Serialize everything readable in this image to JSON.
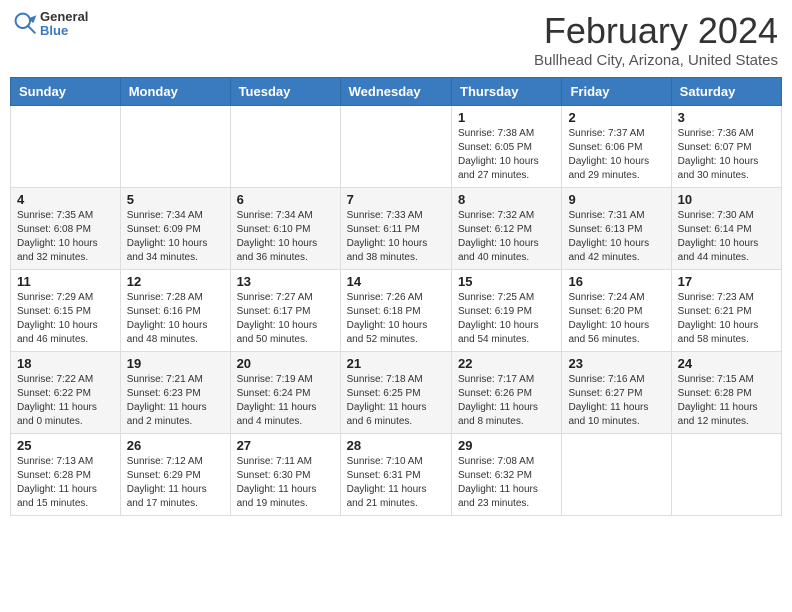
{
  "header": {
    "logo_general": "General",
    "logo_blue": "Blue",
    "month_title": "February 2024",
    "location": "Bullhead City, Arizona, United States"
  },
  "days_of_week": [
    "Sunday",
    "Monday",
    "Tuesday",
    "Wednesday",
    "Thursday",
    "Friday",
    "Saturday"
  ],
  "weeks": [
    [
      {
        "day": "",
        "info": ""
      },
      {
        "day": "",
        "info": ""
      },
      {
        "day": "",
        "info": ""
      },
      {
        "day": "",
        "info": ""
      },
      {
        "day": "1",
        "info": "Sunrise: 7:38 AM\nSunset: 6:05 PM\nDaylight: 10 hours and 27 minutes."
      },
      {
        "day": "2",
        "info": "Sunrise: 7:37 AM\nSunset: 6:06 PM\nDaylight: 10 hours and 29 minutes."
      },
      {
        "day": "3",
        "info": "Sunrise: 7:36 AM\nSunset: 6:07 PM\nDaylight: 10 hours and 30 minutes."
      }
    ],
    [
      {
        "day": "4",
        "info": "Sunrise: 7:35 AM\nSunset: 6:08 PM\nDaylight: 10 hours and 32 minutes."
      },
      {
        "day": "5",
        "info": "Sunrise: 7:34 AM\nSunset: 6:09 PM\nDaylight: 10 hours and 34 minutes."
      },
      {
        "day": "6",
        "info": "Sunrise: 7:34 AM\nSunset: 6:10 PM\nDaylight: 10 hours and 36 minutes."
      },
      {
        "day": "7",
        "info": "Sunrise: 7:33 AM\nSunset: 6:11 PM\nDaylight: 10 hours and 38 minutes."
      },
      {
        "day": "8",
        "info": "Sunrise: 7:32 AM\nSunset: 6:12 PM\nDaylight: 10 hours and 40 minutes."
      },
      {
        "day": "9",
        "info": "Sunrise: 7:31 AM\nSunset: 6:13 PM\nDaylight: 10 hours and 42 minutes."
      },
      {
        "day": "10",
        "info": "Sunrise: 7:30 AM\nSunset: 6:14 PM\nDaylight: 10 hours and 44 minutes."
      }
    ],
    [
      {
        "day": "11",
        "info": "Sunrise: 7:29 AM\nSunset: 6:15 PM\nDaylight: 10 hours and 46 minutes."
      },
      {
        "day": "12",
        "info": "Sunrise: 7:28 AM\nSunset: 6:16 PM\nDaylight: 10 hours and 48 minutes."
      },
      {
        "day": "13",
        "info": "Sunrise: 7:27 AM\nSunset: 6:17 PM\nDaylight: 10 hours and 50 minutes."
      },
      {
        "day": "14",
        "info": "Sunrise: 7:26 AM\nSunset: 6:18 PM\nDaylight: 10 hours and 52 minutes."
      },
      {
        "day": "15",
        "info": "Sunrise: 7:25 AM\nSunset: 6:19 PM\nDaylight: 10 hours and 54 minutes."
      },
      {
        "day": "16",
        "info": "Sunrise: 7:24 AM\nSunset: 6:20 PM\nDaylight: 10 hours and 56 minutes."
      },
      {
        "day": "17",
        "info": "Sunrise: 7:23 AM\nSunset: 6:21 PM\nDaylight: 10 hours and 58 minutes."
      }
    ],
    [
      {
        "day": "18",
        "info": "Sunrise: 7:22 AM\nSunset: 6:22 PM\nDaylight: 11 hours and 0 minutes."
      },
      {
        "day": "19",
        "info": "Sunrise: 7:21 AM\nSunset: 6:23 PM\nDaylight: 11 hours and 2 minutes."
      },
      {
        "day": "20",
        "info": "Sunrise: 7:19 AM\nSunset: 6:24 PM\nDaylight: 11 hours and 4 minutes."
      },
      {
        "day": "21",
        "info": "Sunrise: 7:18 AM\nSunset: 6:25 PM\nDaylight: 11 hours and 6 minutes."
      },
      {
        "day": "22",
        "info": "Sunrise: 7:17 AM\nSunset: 6:26 PM\nDaylight: 11 hours and 8 minutes."
      },
      {
        "day": "23",
        "info": "Sunrise: 7:16 AM\nSunset: 6:27 PM\nDaylight: 11 hours and 10 minutes."
      },
      {
        "day": "24",
        "info": "Sunrise: 7:15 AM\nSunset: 6:28 PM\nDaylight: 11 hours and 12 minutes."
      }
    ],
    [
      {
        "day": "25",
        "info": "Sunrise: 7:13 AM\nSunset: 6:28 PM\nDaylight: 11 hours and 15 minutes."
      },
      {
        "day": "26",
        "info": "Sunrise: 7:12 AM\nSunset: 6:29 PM\nDaylight: 11 hours and 17 minutes."
      },
      {
        "day": "27",
        "info": "Sunrise: 7:11 AM\nSunset: 6:30 PM\nDaylight: 11 hours and 19 minutes."
      },
      {
        "day": "28",
        "info": "Sunrise: 7:10 AM\nSunset: 6:31 PM\nDaylight: 11 hours and 21 minutes."
      },
      {
        "day": "29",
        "info": "Sunrise: 7:08 AM\nSunset: 6:32 PM\nDaylight: 11 hours and 23 minutes."
      },
      {
        "day": "",
        "info": ""
      },
      {
        "day": "",
        "info": ""
      }
    ]
  ]
}
